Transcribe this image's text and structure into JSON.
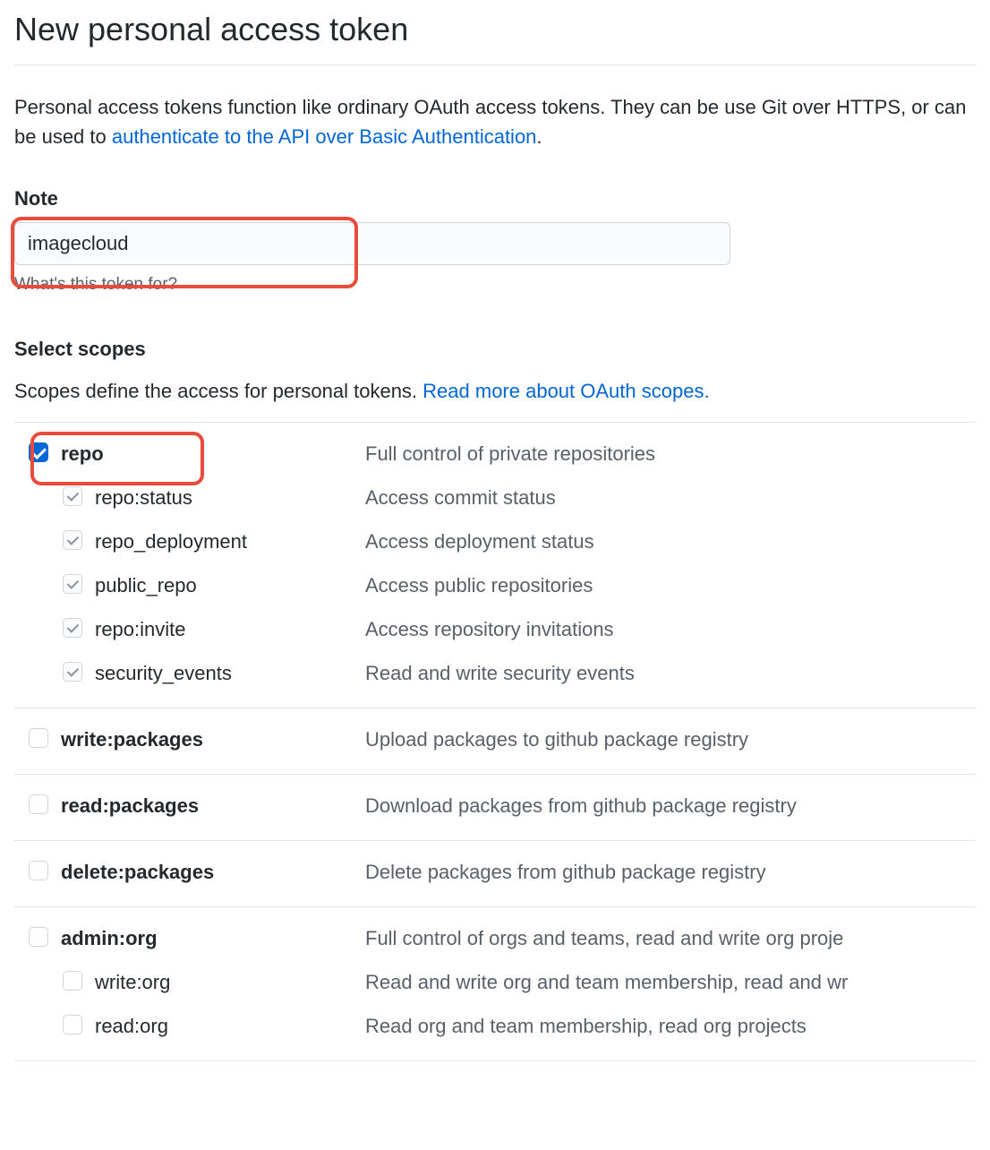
{
  "page": {
    "title": "New personal access token",
    "description_prefix": "Personal access tokens function like ordinary OAuth access tokens. They can be use Git over HTTPS, or can be used to ",
    "description_link": "authenticate to the API over Basic Authentication",
    "description_suffix": "."
  },
  "note_section": {
    "label": "Note",
    "value": "imagecloud",
    "hint": "What's this token for?"
  },
  "scopes_section": {
    "heading": "Select scopes",
    "description_prefix": "Scopes define the access for personal tokens. ",
    "description_link": "Read more about OAuth scopes."
  },
  "scopes": [
    {
      "name": "repo",
      "desc": "Full control of private repositories",
      "checked": true,
      "highlighted": true,
      "children": [
        {
          "name": "repo:status",
          "desc": "Access commit status",
          "disabled_checked": true
        },
        {
          "name": "repo_deployment",
          "desc": "Access deployment status",
          "disabled_checked": true
        },
        {
          "name": "public_repo",
          "desc": "Access public repositories",
          "disabled_checked": true
        },
        {
          "name": "repo:invite",
          "desc": "Access repository invitations",
          "disabled_checked": true
        },
        {
          "name": "security_events",
          "desc": "Read and write security events",
          "disabled_checked": true
        }
      ]
    },
    {
      "name": "write:packages",
      "desc": "Upload packages to github package registry",
      "checked": false,
      "children": []
    },
    {
      "name": "read:packages",
      "desc": "Download packages from github package registry",
      "checked": false,
      "children": []
    },
    {
      "name": "delete:packages",
      "desc": "Delete packages from github package registry",
      "checked": false,
      "children": []
    },
    {
      "name": "admin:org",
      "desc": "Full control of orgs and teams, read and write org proje",
      "checked": false,
      "children": [
        {
          "name": "write:org",
          "desc": "Read and write org and team membership, read and wr",
          "disabled_checked": false
        },
        {
          "name": "read:org",
          "desc": "Read org and team membership, read org projects",
          "disabled_checked": false
        }
      ]
    }
  ]
}
